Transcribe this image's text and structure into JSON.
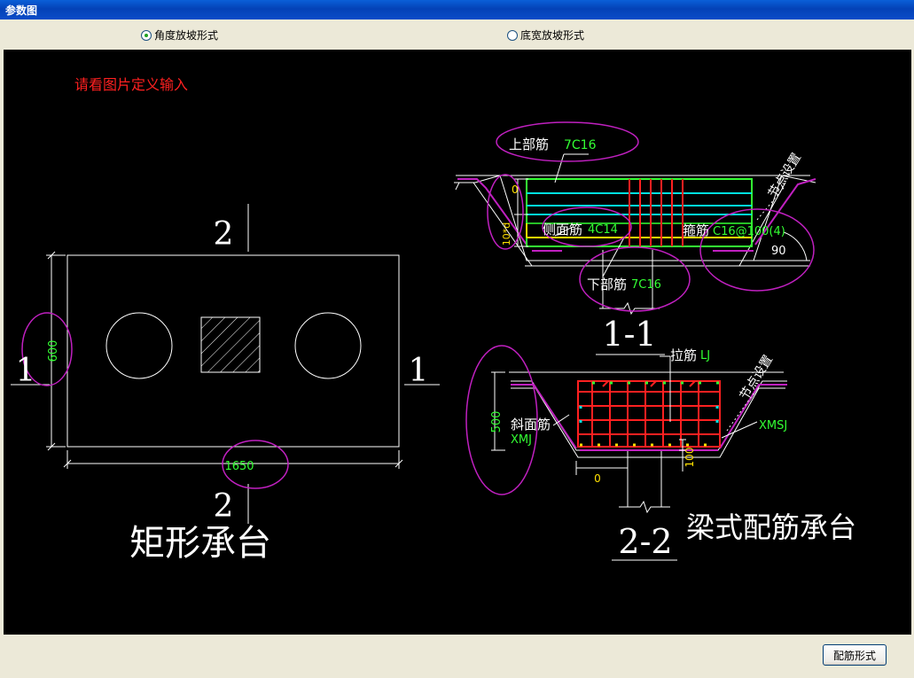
{
  "window": {
    "title": "参数图"
  },
  "options": {
    "angle": {
      "label": "角度放坡形式",
      "selected": true
    },
    "width": {
      "label": "底宽放坡形式",
      "selected": false
    }
  },
  "drawing": {
    "hint": "请看图片定义输入",
    "rect": {
      "dim_height": "600",
      "dim_length": "1650",
      "section_top": "2",
      "section_bottom": "2",
      "section_left": "1",
      "section_right": "1",
      "caption": "矩形承台"
    },
    "s11": {
      "top_rebar_label": "上部筋",
      "top_rebar_value": "7C16",
      "side_rebar_label": "侧面筋",
      "side_rebar_value": "4C14",
      "stirrup_label": "箍筋",
      "stirrup_value": "C16@100(4)",
      "bottom_rebar_label": "下部筋",
      "bottom_rebar_value": "7C16",
      "node_setting": "节点设置",
      "angle_value": "90",
      "dim_zero": "0",
      "dim_10d": "10*d",
      "title": "1-1"
    },
    "s22": {
      "tie_label": "拉筋",
      "tie_value": "LJ",
      "node_setting": "节点设置",
      "slope_label": "斜面筋",
      "slope_value": "XMJ",
      "right_slope_value": "XMSJ",
      "dim_500": "500",
      "dim_100": "100",
      "dim_zero": "0",
      "title": "2-2"
    },
    "beam_caption": "梁式配筋承台"
  },
  "footer": {
    "button_label": "配筋形式"
  }
}
